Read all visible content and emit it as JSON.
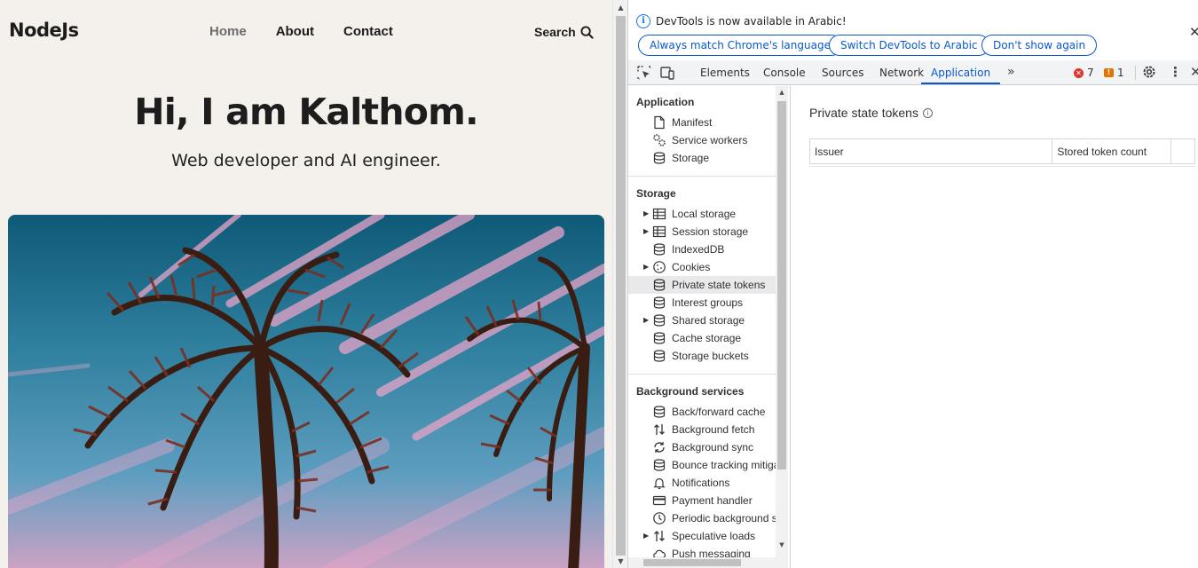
{
  "site": {
    "logo": "NodeJs",
    "nav": [
      {
        "label": "Home",
        "active": true
      },
      {
        "label": "About",
        "active": false
      },
      {
        "label": "Contact",
        "active": false
      }
    ],
    "search_label": "Search",
    "heading": "Hi, I am Kalthom.",
    "subtitle": "Web developer and AI engineer."
  },
  "devtools": {
    "infobar": {
      "message": "DevTools is now available in Arabic!",
      "buttons": [
        "Always match Chrome's language",
        "Switch DevTools to Arabic",
        "Don't show again"
      ]
    },
    "tabs": [
      "Elements",
      "Console",
      "Sources",
      "Network",
      "Application"
    ],
    "active_tab": "Application",
    "error_count": "7",
    "warning_count": "1",
    "sidebar": {
      "application": {
        "title": "Application",
        "items": [
          {
            "label": "Manifest",
            "icon": "file-icon"
          },
          {
            "label": "Service workers",
            "icon": "gears-icon"
          },
          {
            "label": "Storage",
            "icon": "database-icon"
          }
        ]
      },
      "storage": {
        "title": "Storage",
        "items": [
          {
            "label": "Local storage",
            "icon": "table-icon",
            "expandable": true
          },
          {
            "label": "Session storage",
            "icon": "table-icon",
            "expandable": true
          },
          {
            "label": "IndexedDB",
            "icon": "database-icon"
          },
          {
            "label": "Cookies",
            "icon": "cookie-icon",
            "expandable": true
          },
          {
            "label": "Private state tokens",
            "icon": "database-icon",
            "selected": true
          },
          {
            "label": "Interest groups",
            "icon": "database-icon"
          },
          {
            "label": "Shared storage",
            "icon": "database-icon",
            "expandable": true
          },
          {
            "label": "Cache storage",
            "icon": "database-icon"
          },
          {
            "label": "Storage buckets",
            "icon": "database-icon"
          }
        ]
      },
      "background": {
        "title": "Background services",
        "items": [
          {
            "label": "Back/forward cache",
            "icon": "database-icon"
          },
          {
            "label": "Background fetch",
            "icon": "arrows-updown-icon"
          },
          {
            "label": "Background sync",
            "icon": "sync-icon"
          },
          {
            "label": "Bounce tracking mitiga",
            "icon": "database-icon"
          },
          {
            "label": "Notifications",
            "icon": "bell-icon"
          },
          {
            "label": "Payment handler",
            "icon": "card-icon"
          },
          {
            "label": "Periodic background s",
            "icon": "clock-icon"
          },
          {
            "label": "Speculative loads",
            "icon": "arrows-updown-icon",
            "expandable": true
          },
          {
            "label": "Push messaging",
            "icon": "cloud-icon"
          }
        ]
      }
    },
    "panel": {
      "title": "Private state tokens",
      "columns": [
        "Issuer",
        "Stored token count"
      ]
    }
  },
  "colors": {
    "accent": "#0b57d0",
    "error": "#dc362e",
    "warning": "#e37400",
    "site_bg": "#f4f0eb"
  }
}
